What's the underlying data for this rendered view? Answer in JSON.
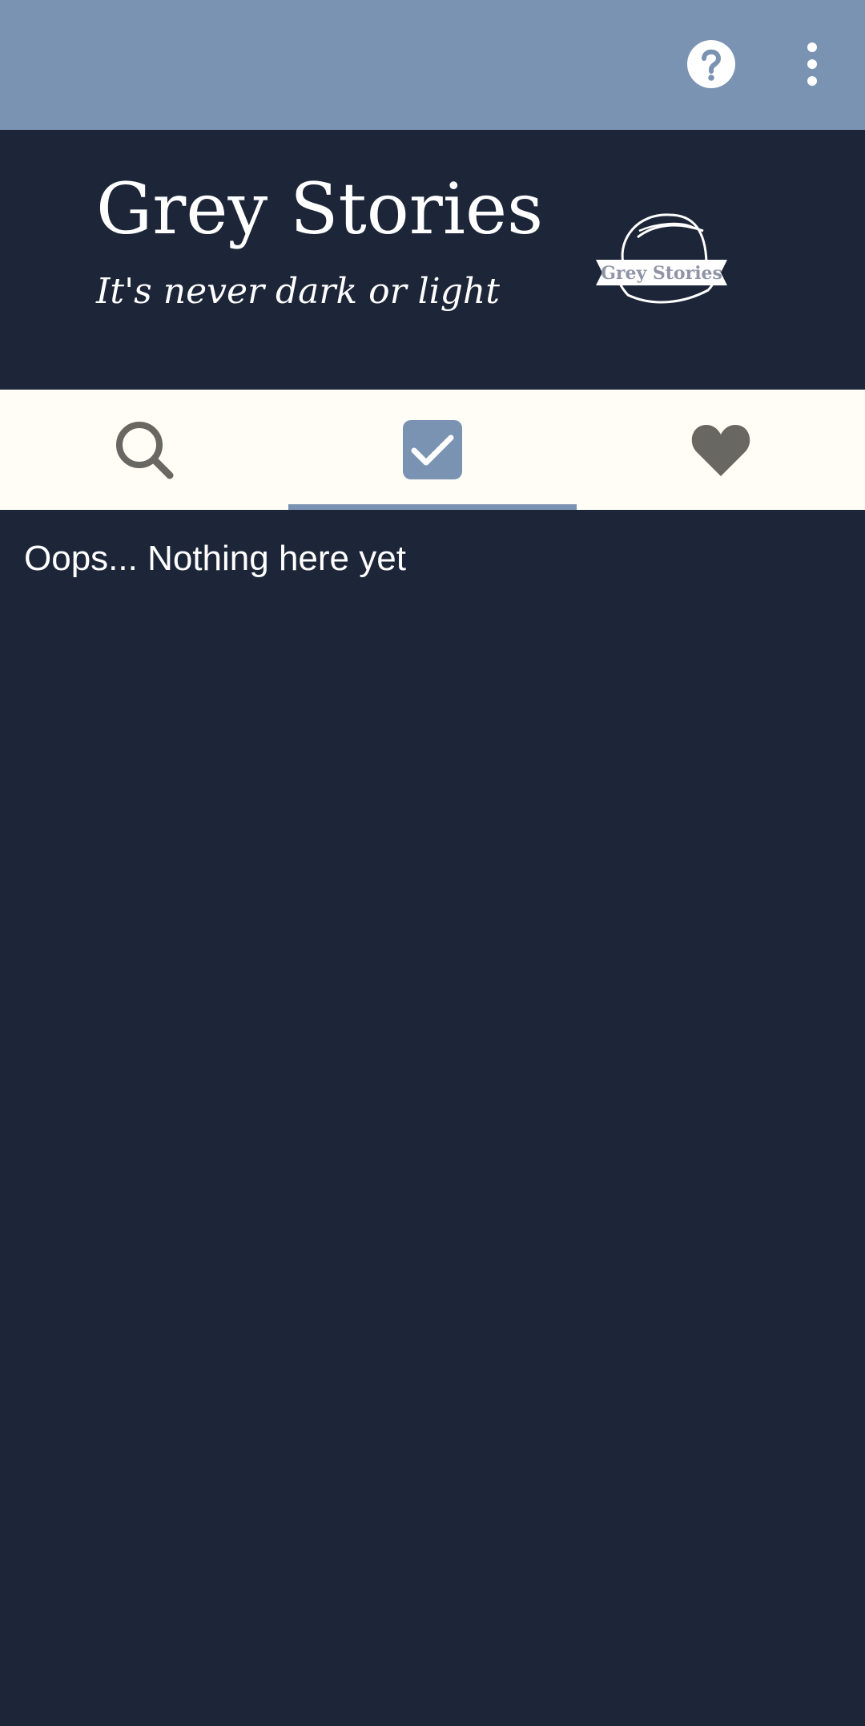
{
  "app": {
    "title": "Grey Stories",
    "subtitle": "It's never dark or light",
    "logo_text": "Grey Stories"
  },
  "toolbar": {
    "icons": [
      "help-icon",
      "more-vert-icon"
    ]
  },
  "tabs": [
    {
      "icon": "search-icon",
      "selected": false
    },
    {
      "icon": "checkbox-checked-icon",
      "selected": true
    },
    {
      "icon": "heart-icon",
      "selected": false
    }
  ],
  "content": {
    "empty_message": "Oops... Nothing here yet"
  },
  "colors": {
    "toolbar": "#7a93b2",
    "background": "#1d2538",
    "tab_bar": "#fffdf6",
    "accent": "#7a93b2",
    "icon_inactive": "#686762",
    "text": "#ffffff"
  }
}
